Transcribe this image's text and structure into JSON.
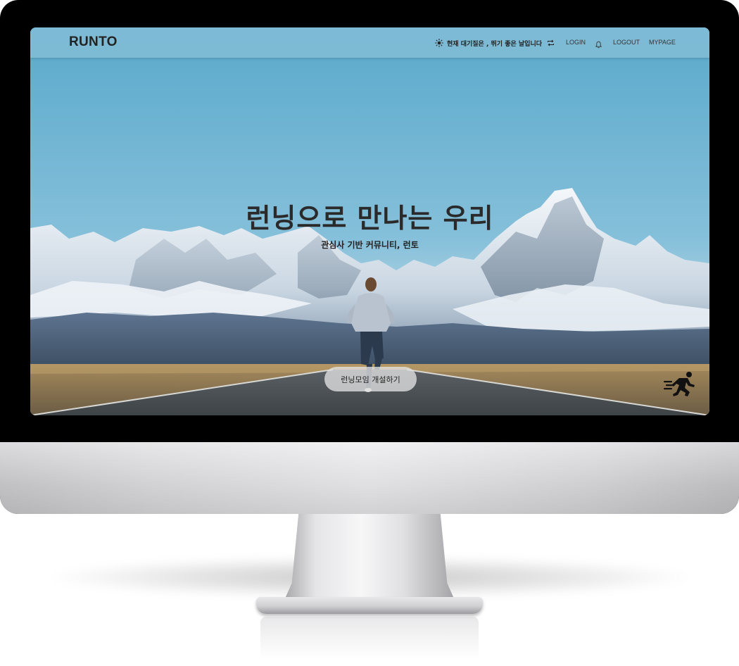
{
  "header": {
    "logo": "RUNTO",
    "weather_text": "현재 대기질은 , 뛰기 좋은 날입니다",
    "nav": {
      "login": "LOGIN",
      "logout": "LOGOUT",
      "mypage": "MYPAGE"
    }
  },
  "hero": {
    "title": "런닝으로 만나는 우리",
    "subtitle": "관심사 기반 커뮤니티, 런토",
    "cta_label": "런닝모임 개설하기"
  },
  "icons": {
    "weather": "sun-icon",
    "refresh": "refresh-icon",
    "notification": "bell-icon",
    "floating": "runner-icon"
  }
}
